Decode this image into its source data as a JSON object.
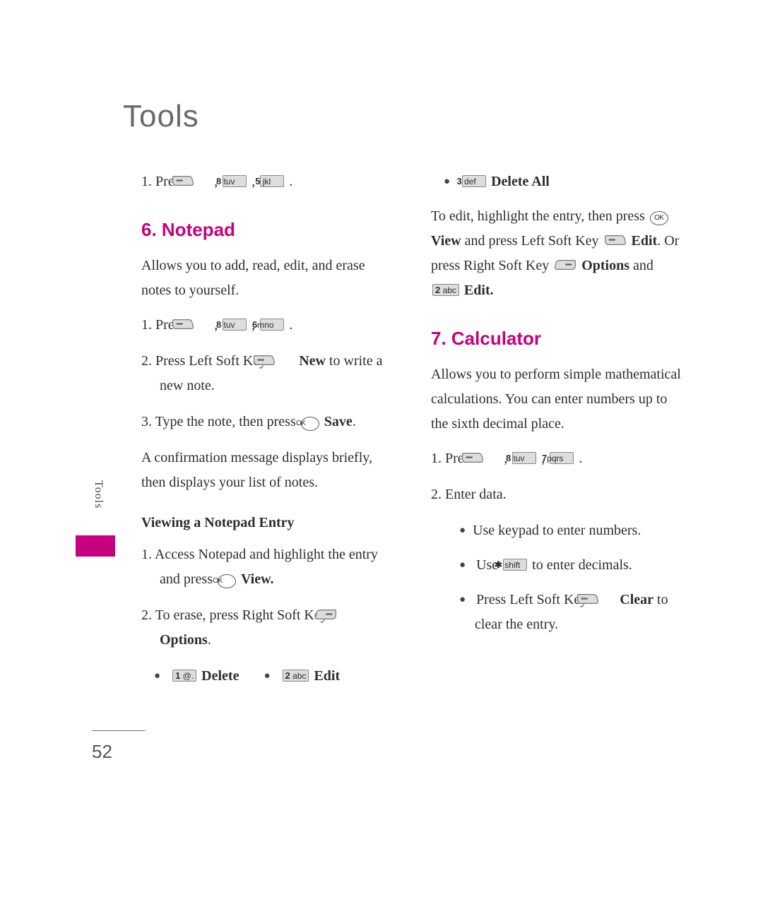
{
  "chapterTitle": "Tools",
  "sideTab": "Tools",
  "pageNumber": "52",
  "left": {
    "topStep": {
      "num": "1.",
      "pre": "Press ",
      "k1": "8 tuv",
      "k2": "5 jkl"
    },
    "section6": {
      "title": "6. Notepad",
      "intro": "Allows you to add, read, edit, and erase notes to yourself.",
      "s1": {
        "num": "1.",
        "pre": "Press ",
        "k1": "8 tuv",
        "k2": "6mno"
      },
      "s2": {
        "num": "2.",
        "a": "Press Left Soft Key ",
        "label": "New",
        "b": "to write a new note."
      },
      "s3": {
        "num": "3.",
        "a": "Type the note, then press ",
        "label": "Save"
      },
      "s3note": "A confirmation message displays briefly, then displays your list of notes.",
      "sub": "Viewing a Notepad Entry",
      "v1": {
        "num": "1.",
        "a": "Access Notepad and highlight the entry and press ",
        "label": "View."
      },
      "v2": {
        "num": "2.",
        "a": "To erase, press Right Soft Key",
        "label": "Options"
      },
      "opts": {
        "o1k": "1 @.",
        "o1": "Delete",
        "o2k": "2 abc",
        "o2": "Edit"
      }
    }
  },
  "right": {
    "del": {
      "k": "3 def",
      "label": "Delete All"
    },
    "edit": {
      "a": "To edit, highlight the entry, then press ",
      "view": "View",
      "b": " and press Left Soft Key ",
      "editLbl": "Edit",
      "c": ". Or press Right Soft Key ",
      "opt": "Options",
      "d": " and ",
      "k": "2 abc",
      "editLbl2": "Edit."
    },
    "section7": {
      "title": "7. Calculator",
      "intro": "Allows you to perform simple mathematical calculations. You can enter numbers up to the sixth decimal place.",
      "s1": {
        "num": "1.",
        "pre": "Press ",
        "k1": "8 tuv",
        "k2": "7pqrs"
      },
      "s2": {
        "num": "2.",
        "text": "Enter data."
      },
      "b1": "Use keypad to enter numbers.",
      "b2a": "Use ",
      "b2k": "✱ shift",
      "b2b": " to enter decimals.",
      "b3a": "Press Left Soft Key ",
      "b3lbl": "Clear",
      "b3b": " to clear the entry."
    }
  }
}
